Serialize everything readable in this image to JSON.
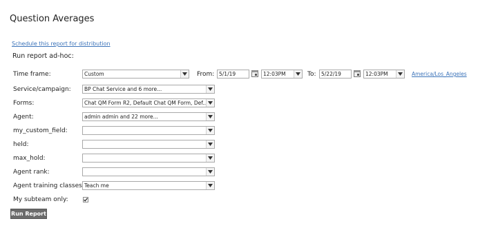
{
  "page": {
    "title": "Question Averages",
    "schedule_link": "Schedule this report for distribution",
    "adhoc_label": "Run report ad-hoc:"
  },
  "form": {
    "time_frame": {
      "label": "Time frame:",
      "value": "Custom"
    },
    "from": {
      "label": "From:",
      "date": "5/1/19",
      "time": "12:03PM"
    },
    "to": {
      "label": "To:",
      "date": "5/22/19",
      "time": "12:03PM"
    },
    "timezone_link": "America/Los_Angeles",
    "service": {
      "label": "Service/campaign:",
      "value": "BP Chat Service and 6 more..."
    },
    "forms": {
      "label": "Forms:",
      "value": "Chat QM Form R2, Default Chat QM Form, Def..."
    },
    "agent": {
      "label": "Agent:",
      "value": "admin admin and 22 more..."
    },
    "my_custom_field": {
      "label": "my_custom_field:",
      "value": ""
    },
    "held": {
      "label": "held:",
      "value": ""
    },
    "max_hold": {
      "label": "max_hold:",
      "value": ""
    },
    "agent_rank": {
      "label": "Agent rank:",
      "value": ""
    },
    "agent_training": {
      "label": "Agent training classes:",
      "value": "Teach me"
    },
    "my_subteam": {
      "label": "My subteam only:",
      "checked": true
    }
  },
  "actions": {
    "run_report": "Run Report"
  },
  "colors": {
    "link": "#3b73b9",
    "button_bg": "#6b6b6b",
    "border": "#a9a9a9"
  }
}
